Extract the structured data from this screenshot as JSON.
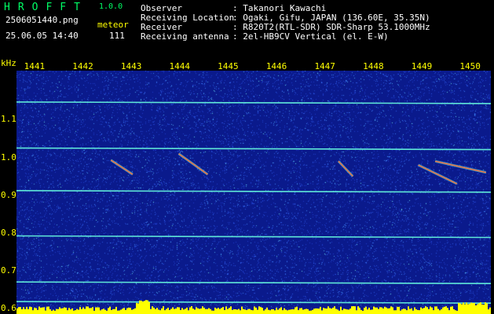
{
  "header": {
    "app_title": "HROFFT",
    "app_version": "1.0.0",
    "file_name": "2506051440.png",
    "mode": "meteor",
    "datetime": "25.06.05 14:40",
    "count": "111",
    "info_rows": [
      {
        "label": "Observer",
        "value": ": Takanori Kawachi"
      },
      {
        "label": "Receiving Location",
        "value": ": Ogaki, Gifu, JAPAN (136.60E, 35.35N)"
      },
      {
        "label": "Receiver",
        "value": ": R820T2(RTL-SDR) SDR-Sharp 53.1000MHz"
      },
      {
        "label": "Receiving antenna",
        "value": ": 2el-HB9CV Vertical (el. E-W)"
      }
    ]
  },
  "colors": {
    "background": "#000000",
    "plot_background": "#0a1a8c",
    "axis_text": "#ffff00",
    "title": "#00ff66",
    "carrier_line": "#5fe8d8",
    "meteor_trace": "#ff6a3a",
    "amplitude_bar": "#ffff00"
  },
  "chart_data": {
    "type": "heatmap",
    "ylabel": "kHz",
    "x_ticks": [
      "1441",
      "1442",
      "1443",
      "1444",
      "1445",
      "1446",
      "1447",
      "1448",
      "1449",
      "1450"
    ],
    "y_ticks": [
      "1.1",
      "1.0",
      "0.9",
      "0.8",
      "0.7",
      "0.6"
    ],
    "xlim": [
      1440.6,
      1450.4
    ],
    "ylim": [
      0.585,
      1.23
    ],
    "carrier_lines_khz": [
      1.147,
      1.025,
      0.912,
      0.792,
      0.67,
      0.618
    ],
    "meteor_traces": [
      {
        "x": [
          1442.55,
          1443.0
        ],
        "y": [
          0.993,
          0.955
        ]
      },
      {
        "x": [
          1443.95,
          1444.55
        ],
        "y": [
          1.01,
          0.955
        ]
      },
      {
        "x": [
          1447.25,
          1447.55
        ],
        "y": [
          0.99,
          0.95
        ]
      },
      {
        "x": [
          1448.9,
          1449.7
        ],
        "y": [
          0.98,
          0.93
        ]
      },
      {
        "x": [
          1449.25,
          1450.3
        ],
        "y": [
          0.99,
          0.96
        ]
      }
    ],
    "grid": false
  }
}
